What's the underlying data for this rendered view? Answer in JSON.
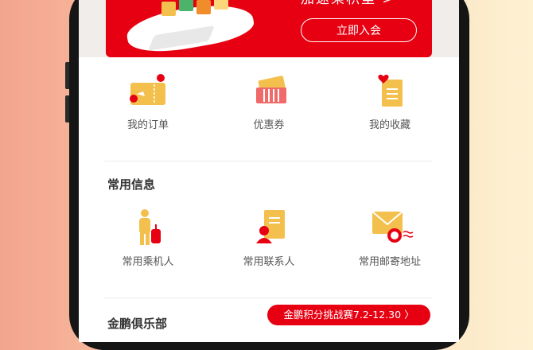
{
  "banner": {
    "partial_text": "加速乘积里 >",
    "join_button": "立即入会"
  },
  "quick_actions": [
    {
      "label": "我的订单",
      "icon": "ticket-icon"
    },
    {
      "label": "优惠券",
      "icon": "coupon-icon"
    },
    {
      "label": "我的收藏",
      "icon": "favorites-icon"
    }
  ],
  "common_info": {
    "title": "常用信息",
    "items": [
      {
        "label": "常用乘机人",
        "icon": "passenger-icon"
      },
      {
        "label": "常用联系人",
        "icon": "contact-icon"
      },
      {
        "label": "常用邮寄地址",
        "icon": "mail-address-icon"
      }
    ]
  },
  "club": {
    "title": "金鹏俱乐部",
    "challenge_button": "金鹏积分挑战赛7.2-12.30",
    "challenge_arrow": "〉"
  },
  "colors": {
    "brand_red": "#e60012",
    "icon_gold": "#f4c04d"
  }
}
